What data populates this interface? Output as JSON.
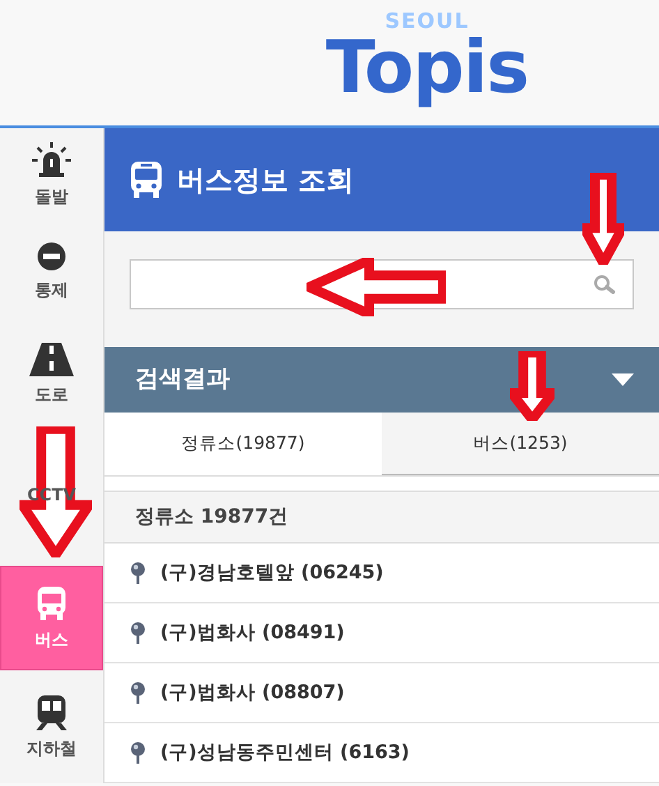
{
  "logo": {
    "small": "SEOUL",
    "big": "Topis"
  },
  "sidebar": {
    "items": [
      {
        "kind": "siren",
        "label": "돌발",
        "selected": false
      },
      {
        "kind": "noentry",
        "label": "통제",
        "selected": false
      },
      {
        "kind": "road",
        "label": "도로",
        "selected": false
      },
      {
        "kind": "cctv",
        "label": "CCTV",
        "selected": false
      },
      {
        "kind": "bus",
        "label": "버스",
        "selected": true
      },
      {
        "kind": "subway",
        "label": "지하철",
        "selected": false
      }
    ]
  },
  "panel": {
    "title": "버스정보 조회",
    "results_title": "검색결과",
    "tabs": [
      {
        "label": "정류소(19877)",
        "selected": true
      },
      {
        "label": "버스(1253)",
        "selected": false
      }
    ],
    "count": "정류소 19877건",
    "stops": [
      {
        "name": "(구)경남호텔앞 (06245)"
      },
      {
        "name": "(구)법화사 (08491)"
      },
      {
        "name": "(구)법화사 (08807)"
      },
      {
        "name": "(구)성남동주민센터 (6163)"
      }
    ]
  },
  "annotations": [
    {
      "kind": "down"
    },
    {
      "kind": "left"
    },
    {
      "kind": "down"
    },
    {
      "kind": "down"
    }
  ]
}
